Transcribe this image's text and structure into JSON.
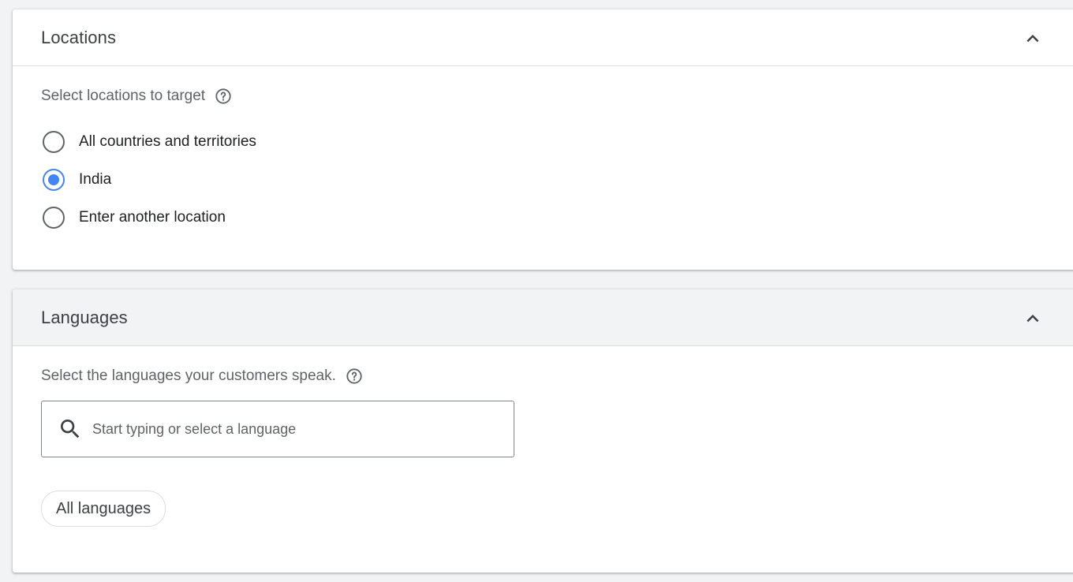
{
  "locations": {
    "title": "Locations",
    "prompt": "Select locations to target",
    "options": [
      {
        "label": "All countries and territories",
        "checked": false
      },
      {
        "label": "India",
        "checked": true
      },
      {
        "label": "Enter another location",
        "checked": false
      }
    ],
    "collapse_icon": "chevron-up-icon",
    "help_icon": "help-circle-icon"
  },
  "languages": {
    "title": "Languages",
    "prompt": "Select the languages your customers speak.",
    "search": {
      "placeholder": "Start typing or select a language",
      "value": ""
    },
    "chip_label": "All languages",
    "collapse_icon": "chevron-up-icon",
    "help_icon": "help-circle-icon",
    "search_icon": "search-icon"
  },
  "colors": {
    "accent": "#4285f4",
    "text": "#3c4043",
    "muted": "#5f6368",
    "header_bg_active": "#f1f3f4"
  }
}
